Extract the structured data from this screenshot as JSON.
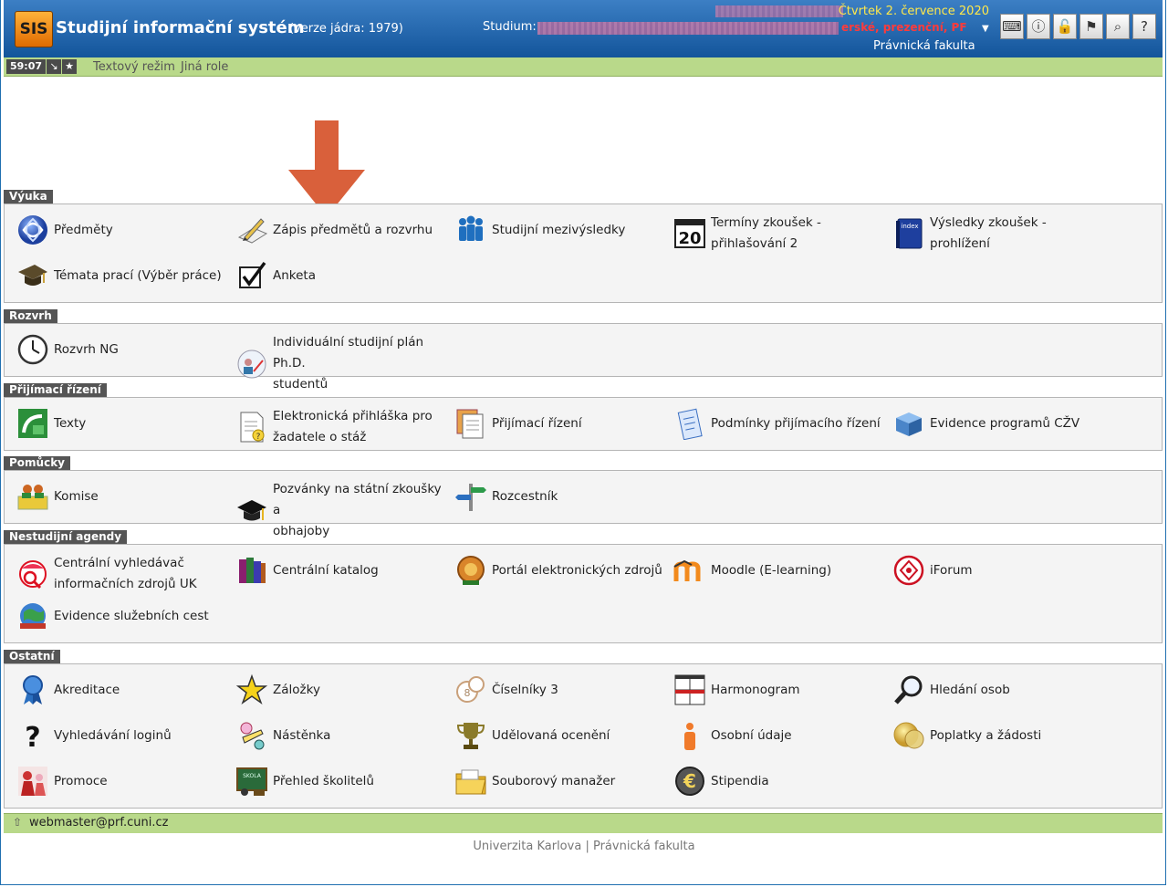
{
  "header": {
    "logo": "SIS",
    "title": "Studijní informační systém",
    "version": "(verze jádra: 1979)",
    "study_label": "Studium:",
    "date": "Čtvrtek 2. července 2020",
    "study_type": "erské, prezenční, PF",
    "faculty": "Právnická fakulta"
  },
  "subbar": {
    "timer": "59:07",
    "text_mode": "Textový režim",
    "other_role": "Jiná role"
  },
  "sections": [
    {
      "title": "Výuka",
      "items": [
        {
          "label1": "Předměty",
          "label2": ""
        },
        {
          "label1": "Zápis předmětů a rozvrhu",
          "label2": ""
        },
        {
          "label1": "Studijní mezivýsledky",
          "label2": ""
        },
        {
          "label1": "Termíny zkoušek -",
          "label2": "přihlašování 2"
        },
        {
          "label1": "Výsledky zkoušek - prohlížení",
          "label2": ""
        },
        {
          "label1": "Témata prací (Výběr práce)",
          "label2": ""
        },
        {
          "label1": "Anketa",
          "label2": ""
        }
      ]
    },
    {
      "title": "Rozvrh",
      "items": [
        {
          "label1": "Rozvrh NG",
          "label2": ""
        },
        {
          "label1": "Individuální studijní plán Ph.D.",
          "label2": "studentů"
        }
      ]
    },
    {
      "title": "Přijímací řízení",
      "items": [
        {
          "label1": "Texty",
          "label2": ""
        },
        {
          "label1": "Elektronická přihláška pro",
          "label2": "žadatele o stáž"
        },
        {
          "label1": "Přijímací řízení",
          "label2": ""
        },
        {
          "label1": "Podmínky přijímacího řízení",
          "label2": ""
        },
        {
          "label1": "Evidence programů CŽV",
          "label2": ""
        }
      ]
    },
    {
      "title": "Pomůcky",
      "items": [
        {
          "label1": "Komise",
          "label2": ""
        },
        {
          "label1": "Pozvánky na státní zkoušky a",
          "label2": "obhajoby"
        },
        {
          "label1": "Rozcestník",
          "label2": ""
        }
      ]
    },
    {
      "title": "Nestudijní agendy",
      "items": [
        {
          "label1": "Centrální vyhledávač",
          "label2": "informačních zdrojů UK"
        },
        {
          "label1": "Centrální katalog",
          "label2": ""
        },
        {
          "label1": "Portál elektronických zdrojů",
          "label2": ""
        },
        {
          "label1": "Moodle (E-learning)",
          "label2": ""
        },
        {
          "label1": "iForum",
          "label2": ""
        },
        {
          "label1": "Evidence služebních cest",
          "label2": ""
        }
      ]
    },
    {
      "title": "Ostatní",
      "items": [
        {
          "label1": "Akreditace",
          "label2": ""
        },
        {
          "label1": "Záložky",
          "label2": ""
        },
        {
          "label1": "Číselníky 3",
          "label2": ""
        },
        {
          "label1": "Harmonogram",
          "label2": ""
        },
        {
          "label1": "Hledání osob",
          "label2": ""
        },
        {
          "label1": "Vyhledávání loginů",
          "label2": ""
        },
        {
          "label1": "Nástěnka",
          "label2": ""
        },
        {
          "label1": "Udělovaná ocenění",
          "label2": ""
        },
        {
          "label1": "Osobní údaje",
          "label2": ""
        },
        {
          "label1": "Poplatky a žádosti",
          "label2": ""
        },
        {
          "label1": "Promoce",
          "label2": ""
        },
        {
          "label1": "Přehled školitelů",
          "label2": ""
        },
        {
          "label1": "Souborový manažer",
          "label2": ""
        },
        {
          "label1": "Stipendia",
          "label2": ""
        }
      ]
    }
  ],
  "footer": {
    "email": "webmaster@prf.cuni.cz",
    "university": "Univerzita Karlova",
    "separator": "|",
    "faculty": "Právnická fakulta"
  },
  "colors": {
    "header_blue": "#1f63a8",
    "green_bar": "#b9d98a",
    "section_title": "#555555",
    "arrow": "#d9603b"
  }
}
